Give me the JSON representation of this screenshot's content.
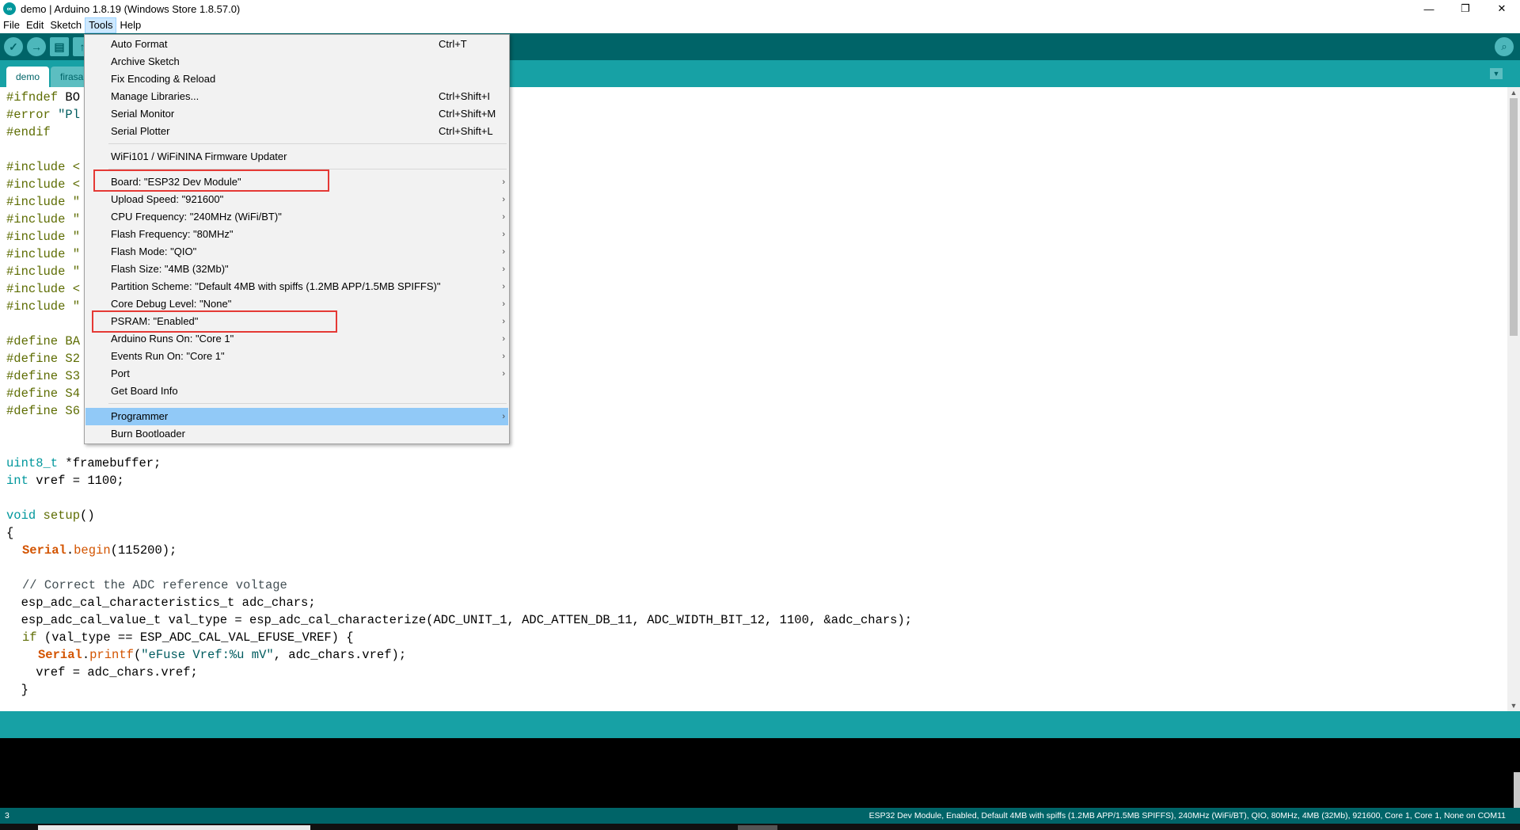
{
  "window": {
    "title": "demo | Arduino 1.8.19 (Windows Store 1.8.57.0)",
    "minimize": "—",
    "maximize": "❐",
    "close": "✕"
  },
  "menubar": [
    "File",
    "Edit",
    "Sketch",
    "Tools",
    "Help"
  ],
  "tabs": {
    "active": "demo",
    "inactive": "firasa"
  },
  "tools_menu": {
    "items": [
      {
        "label": "Auto Format",
        "shortcut": "Ctrl+T"
      },
      {
        "label": "Archive Sketch",
        "shortcut": ""
      },
      {
        "label": "Fix Encoding & Reload",
        "shortcut": ""
      },
      {
        "label": "Manage Libraries...",
        "shortcut": "Ctrl+Shift+I"
      },
      {
        "label": "Serial Monitor",
        "shortcut": "Ctrl+Shift+M"
      },
      {
        "label": "Serial Plotter",
        "shortcut": "Ctrl+Shift+L"
      },
      {
        "label": "WiFi101 / WiFiNINA Firmware Updater",
        "shortcut": ""
      },
      {
        "label": "Board: \"ESP32 Dev Module\"",
        "shortcut": ""
      },
      {
        "label": "Upload Speed: \"921600\"",
        "shortcut": ""
      },
      {
        "label": "CPU Frequency: \"240MHz (WiFi/BT)\"",
        "shortcut": ""
      },
      {
        "label": "Flash Frequency: \"80MHz\"",
        "shortcut": ""
      },
      {
        "label": "Flash Mode: \"QIO\"",
        "shortcut": ""
      },
      {
        "label": "Flash Size: \"4MB (32Mb)\"",
        "shortcut": ""
      },
      {
        "label": "Partition Scheme: \"Default 4MB with spiffs (1.2MB APP/1.5MB SPIFFS)\"",
        "shortcut": ""
      },
      {
        "label": "Core Debug Level: \"None\"",
        "shortcut": ""
      },
      {
        "label": "PSRAM: \"Enabled\"",
        "shortcut": ""
      },
      {
        "label": "Arduino Runs On: \"Core 1\"",
        "shortcut": ""
      },
      {
        "label": "Events Run On: \"Core 1\"",
        "shortcut": ""
      },
      {
        "label": "Port",
        "shortcut": ""
      },
      {
        "label": "Get Board Info",
        "shortcut": ""
      },
      {
        "label": "Programmer",
        "shortcut": ""
      },
      {
        "label": "Burn Bootloader",
        "shortcut": ""
      }
    ],
    "arrow": "›"
  },
  "code": {
    "l1a": "#ifndef",
    "l1b": " BO",
    "l2a": "#error",
    "l2b": " \"Pl",
    "l3": "#endif",
    "inc": [
      "#include <",
      "#include <",
      "#include \"",
      "#include \"",
      "#include \"",
      "#include \"",
      "#include \"",
      "#include <",
      "#include \""
    ],
    "def": [
      "#define BA",
      "#define S2",
      "#define S3",
      "#define S4",
      "#define S6"
    ],
    "fb_type": "uint8_t",
    "fb_rest": " *framebuffer;",
    "vref_type": "int",
    "vref_rest": " vref = 1100;",
    "setup_type": "void",
    "setup_name": " setup",
    "setup_rest": "()",
    "brace_open": "{",
    "serial_obj": "Serial",
    "serial_dot": ".",
    "serial_fn": "begin",
    "serial_rest": "(115200);",
    "comment": "// Correct the ADC reference voltage",
    "adc_chars": "  esp_adc_cal_characteristics_t adc_chars;",
    "val_type": "  esp_adc_cal_value_t val_type = esp_adc_cal_characterize(ADC_UNIT_1, ADC_ATTEN_DB_11, ADC_WIDTH_BIT_12, 1100, &adc_chars);",
    "if_kw": "if",
    "if_rest": " (val_type == ESP_ADC_CAL_VAL_EFUSE_VREF) {",
    "printf_obj": "Serial",
    "printf_fn": "printf",
    "printf_str": "\"eFuse Vref:%u mV\"",
    "printf_rest": ", adc_chars.vref);",
    "vref_assign": "    vref = adc_chars.vref;",
    "brace_close": "  }"
  },
  "footer": {
    "line": "3",
    "board": "ESP32 Dev Module, Enabled, Default 4MB with spiffs (1.2MB APP/1.5MB SPIFFS), 240MHz (WiFi/BT), QIO, 80MHz, 4MB (32Mb), 921600, Core 1, Core 1, None on COM11"
  }
}
